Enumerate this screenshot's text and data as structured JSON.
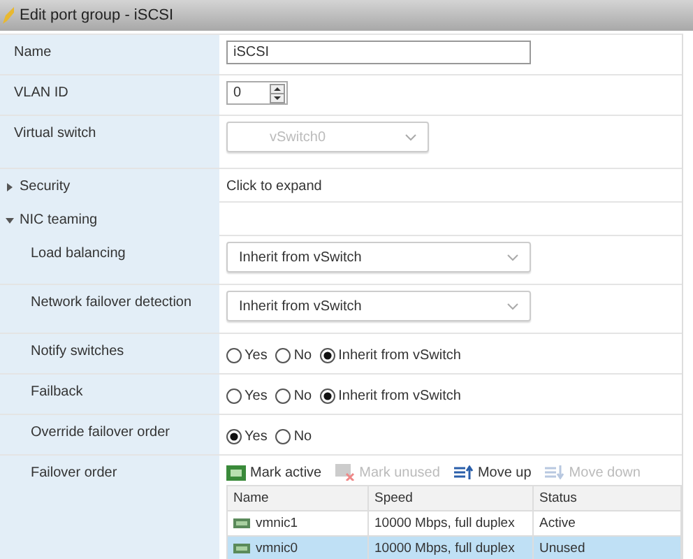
{
  "window": {
    "title": "Edit port group - iSCSI"
  },
  "rows": [
    {
      "kind": "text",
      "label": "Name",
      "value": "iSCSI"
    },
    {
      "kind": "number",
      "label": "VLAN ID",
      "value": "0"
    },
    {
      "kind": "select",
      "label": "Virtual switch",
      "value": "vSwitch0",
      "disabled": true
    },
    {
      "kind": "section",
      "label": "Security",
      "expanded": false,
      "summary": "Click to expand"
    },
    {
      "kind": "section",
      "label": "NIC teaming",
      "expanded": true,
      "children": [
        {
          "kind": "select",
          "label": "Load balancing",
          "value": "Inherit from vSwitch",
          "disabled": false
        },
        {
          "kind": "select",
          "label": "Network failover detection",
          "value": "Inherit from vSwitch",
          "disabled": false
        },
        {
          "kind": "radio",
          "label": "Notify switches",
          "options": [
            {
              "label": "Yes",
              "selected": false
            },
            {
              "label": "No",
              "selected": false
            },
            {
              "label": "Inherit from vSwitch",
              "selected": true
            }
          ]
        },
        {
          "kind": "radio",
          "label": "Failback",
          "options": [
            {
              "label": "Yes",
              "selected": false
            },
            {
              "label": "No",
              "selected": false
            },
            {
              "label": "Inherit from vSwitch",
              "selected": true
            }
          ]
        },
        {
          "kind": "radio",
          "label": "Override failover order",
          "options": [
            {
              "label": "Yes",
              "selected": true
            },
            {
              "label": "No",
              "selected": false
            }
          ]
        },
        {
          "kind": "failover",
          "label": "Failover order",
          "toolbar": [
            {
              "kind": "mark-active",
              "label": "Mark active",
              "disabled": false
            },
            {
              "kind": "mark-unused",
              "label": "Mark unused",
              "disabled": true
            },
            {
              "kind": "move-up",
              "label": "Move up",
              "disabled": false
            },
            {
              "kind": "move-down",
              "label": "Move down",
              "disabled": true
            }
          ],
          "columns": [
            "Name",
            "Speed",
            "Status"
          ],
          "nics": [
            {
              "name": "vmnic1",
              "speed": "10000 Mbps, full duplex",
              "status": "Active",
              "selected": false
            },
            {
              "name": "vmnic0",
              "speed": "10000 Mbps, full duplex",
              "status": "Unused",
              "selected": true
            }
          ]
        }
      ]
    }
  ]
}
